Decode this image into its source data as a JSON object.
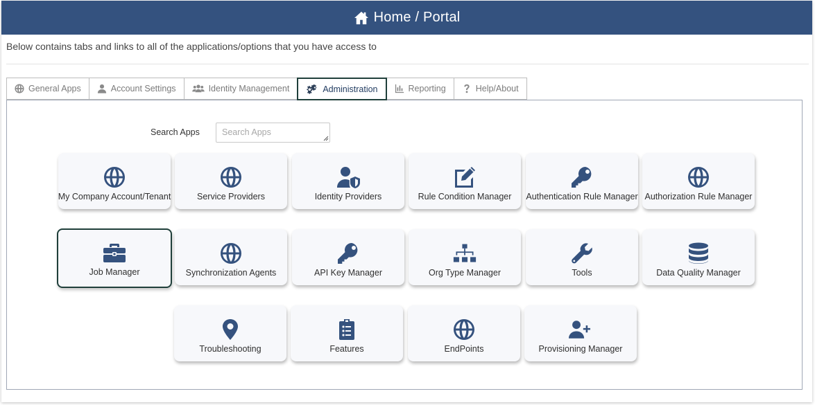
{
  "header": {
    "title": "Home / Portal",
    "icon": "home-icon"
  },
  "subtitle": "Below contains tabs and links to all of the applications/options that you have access to",
  "tabs": [
    {
      "label": "General Apps",
      "icon": "globe-icon"
    },
    {
      "label": "Account Settings",
      "icon": "user-icon"
    },
    {
      "label": "Identity Management",
      "icon": "users-icon"
    },
    {
      "label": "Administration",
      "icon": "cogs-icon",
      "active": true
    },
    {
      "label": "Reporting",
      "icon": "bar-chart-icon"
    },
    {
      "label": "Help/About",
      "icon": "question-icon"
    }
  ],
  "search": {
    "label": "Search Apps",
    "placeholder": "Search Apps",
    "value": ""
  },
  "apps": [
    {
      "label": "My Company Account/Tenant",
      "icon": "globe-icon"
    },
    {
      "label": "Service Providers",
      "icon": "globe-icon"
    },
    {
      "label": "Identity Providers",
      "icon": "user-shield-icon"
    },
    {
      "label": "Rule Condition Manager",
      "icon": "edit-icon"
    },
    {
      "label": "Authentication Rule Manager",
      "icon": "key-icon"
    },
    {
      "label": "Authorization Rule Manager",
      "icon": "globe-icon"
    },
    {
      "label": "Job Manager",
      "icon": "toolbox-icon",
      "selected": true
    },
    {
      "label": "Synchronization Agents",
      "icon": "globe-icon"
    },
    {
      "label": "API Key Manager",
      "icon": "key-icon"
    },
    {
      "label": "Org Type Manager",
      "icon": "sitemap-icon"
    },
    {
      "label": "Tools",
      "icon": "wrench-icon"
    },
    {
      "label": "Data Quality Manager",
      "icon": "database-icon"
    },
    {
      "label": "Troubleshooting",
      "icon": "map-marker-icon"
    },
    {
      "label": "Features",
      "icon": "clipboard-list-icon"
    },
    {
      "label": "EndPoints",
      "icon": "globe-icon"
    },
    {
      "label": "Provisioning Manager",
      "icon": "user-plus-icon"
    }
  ],
  "colors": {
    "header_bg": "#34527f",
    "icon": "#35527e",
    "focus_border": "#1f3f3a",
    "tile_bg": "#f7f8fb"
  }
}
